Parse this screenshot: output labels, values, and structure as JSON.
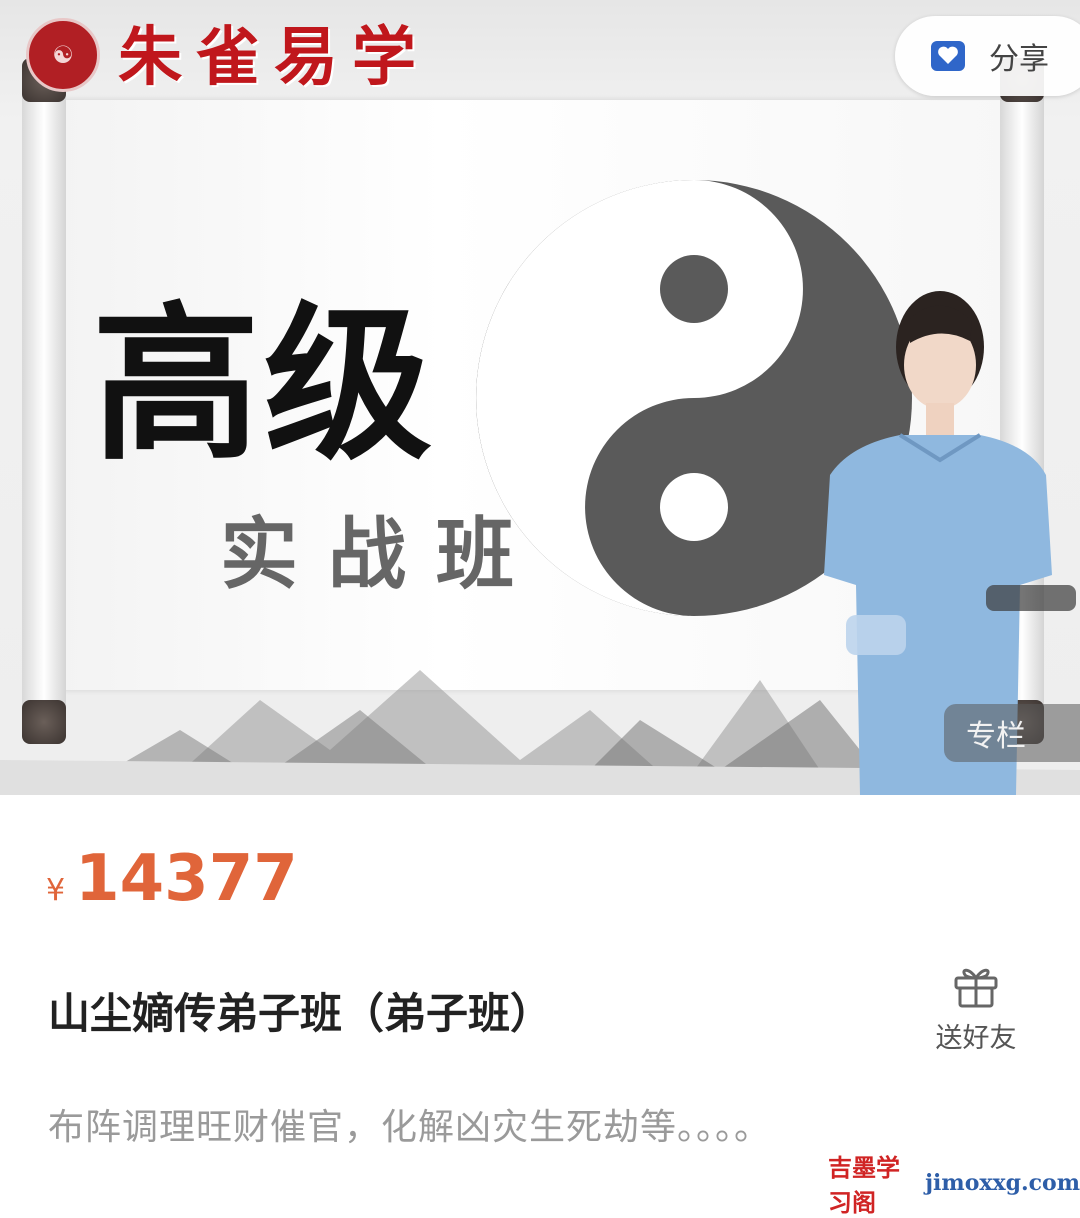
{
  "banner": {
    "brand": "朱雀易学",
    "title_big": "高级",
    "title_sub": "实战班",
    "share_label": "分享",
    "column_tag": "专栏"
  },
  "product": {
    "currency": "¥",
    "price": "14377",
    "title": "山尘嫡传弟子班（弟子班）",
    "gift_label": "送好友",
    "description": "布阵调理旺财催官，化解凶灾生死劫等。。。。"
  },
  "watermark": {
    "text": "吉墨学习阁",
    "url": "jimoxxg.com"
  },
  "colors": {
    "price": "#e0653a",
    "brand_red": "#c0171c",
    "title": "#222222",
    "description": "#9a9a9a"
  }
}
